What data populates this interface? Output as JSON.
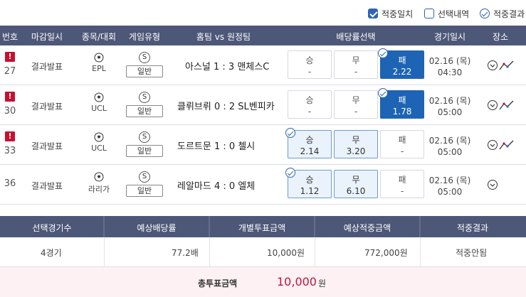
{
  "filters": [
    {
      "label": "적중일치",
      "state": "checked"
    },
    {
      "label": "선택내역",
      "state": "unchecked"
    },
    {
      "label": "적중결과",
      "state": "circle-check"
    }
  ],
  "table": {
    "headers": [
      "번호",
      "마감일시",
      "종목/대회",
      "게임유형",
      "홈팀 vs 원정팀",
      "배당률선택",
      "경기일시",
      "장소"
    ],
    "rows": [
      {
        "alert": "!",
        "no": "27",
        "status": "결과발표",
        "sport_icon": "soccer-ball-icon",
        "league": "EPL",
        "type_badge": "S",
        "type": "일반",
        "match": "아스널 1 : 3 맨체스C",
        "odds": [
          {
            "label": "승",
            "value": "-"
          },
          {
            "label": "무",
            "value": "-"
          },
          {
            "label": "패",
            "value": "2.22"
          }
        ],
        "date": "02.16 (목)",
        "time": "04:30"
      },
      {
        "alert": "!",
        "no": "30",
        "status": "결과발표",
        "sport_icon": "soccer-ball-icon",
        "league": "UCL",
        "type_badge": "S",
        "type": "일반",
        "match": "클뤼브뤼 0 : 2 SL벤피카",
        "odds": [
          {
            "label": "승",
            "value": "-"
          },
          {
            "label": "무",
            "value": "-"
          },
          {
            "label": "패",
            "value": "1.78"
          }
        ],
        "date": "02.16 (목)",
        "time": "05:00"
      },
      {
        "alert": "!",
        "no": "33",
        "status": "결과발표",
        "sport_icon": "soccer-ball-icon",
        "league": "UCL",
        "type_badge": "S",
        "type": "일반",
        "match": "도르트문 1 : 0 첼시",
        "odds": [
          {
            "label": "승",
            "value": "2.14"
          },
          {
            "label": "무",
            "value": "3.20"
          },
          {
            "label": "패",
            "value": "-"
          }
        ],
        "date": "02.16 (목)",
        "time": "05:00"
      },
      {
        "alert": "",
        "no": "36",
        "status": "결과발표",
        "sport_icon": "soccer-ball-icon",
        "league": "라리가",
        "type_badge": "S",
        "type": "일반",
        "match": "레알마드 4 : 0 엘체",
        "odds": [
          {
            "label": "승",
            "value": "1.12"
          },
          {
            "label": "무",
            "value": "6.10"
          },
          {
            "label": "패",
            "value": "-"
          }
        ],
        "date": "02.16 (목)",
        "time": "05:00"
      }
    ]
  },
  "summary": {
    "headers": [
      "선택경기수",
      "예상배당률",
      "개별투표금액",
      "예상적중금액",
      "적중결과"
    ],
    "values": [
      "4경기",
      "77.2배",
      "10,000원",
      "772,000원",
      "적중안됨"
    ],
    "total_label": "총투표금액",
    "total_amount": "10,000",
    "total_unit": "원"
  },
  "colors": {
    "header_bg": "#4d5878",
    "selected_odd": "#1e64b4",
    "alert": "#c8102e",
    "total_amount": "#c0143c"
  }
}
